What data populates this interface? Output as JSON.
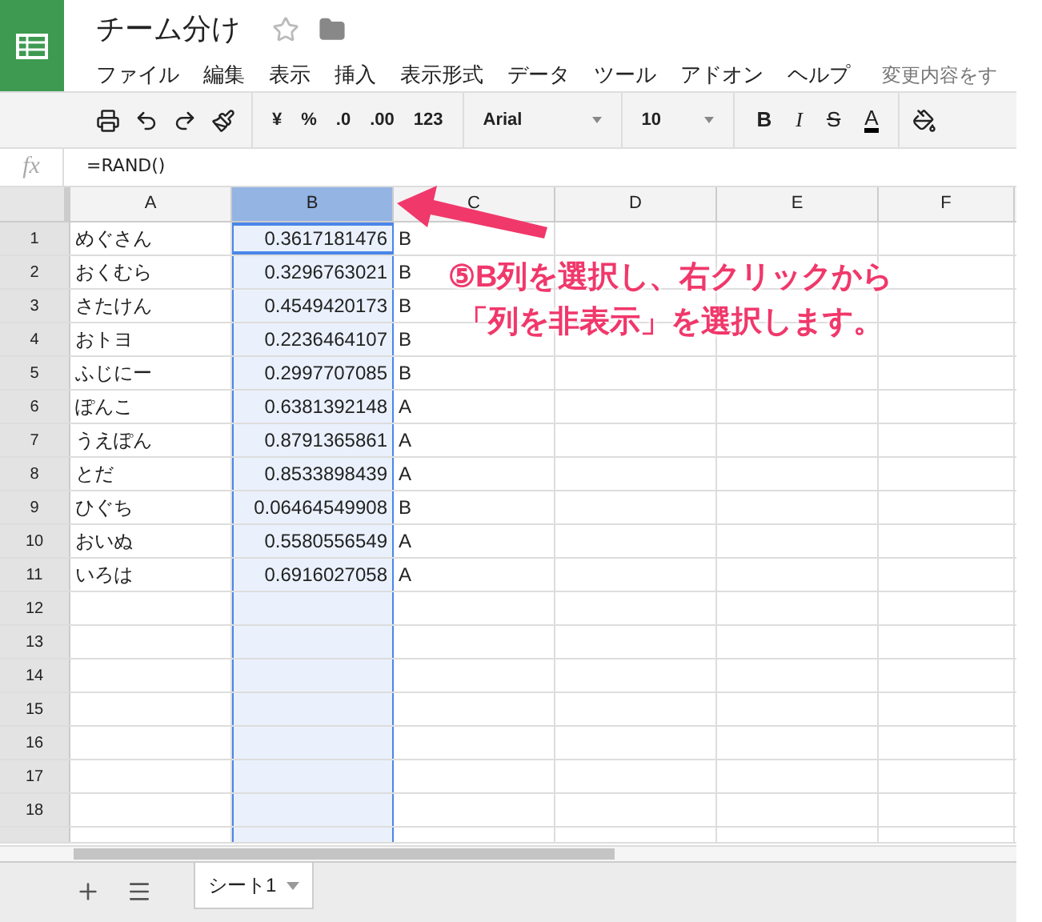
{
  "app": {
    "title": "チーム分け",
    "starred": false,
    "menu": [
      "ファイル",
      "編集",
      "表示",
      "挿入",
      "表示形式",
      "データ",
      "ツール",
      "アドオン",
      "ヘルプ"
    ],
    "save_status": "変更内容をす"
  },
  "toolbar": {
    "format_buttons": [
      "¥",
      "%",
      ".0",
      ".00",
      "123"
    ],
    "font": "Arial",
    "font_size": "10",
    "text_buttons": [
      {
        "label": "B",
        "kind": "bold"
      },
      {
        "label": "I",
        "kind": "italic"
      },
      {
        "label": "S",
        "kind": "strike"
      },
      {
        "label": "A",
        "kind": "color"
      }
    ]
  },
  "formula_bar": {
    "label": "fx",
    "value": "=RAND()"
  },
  "sheet": {
    "columns": [
      {
        "label": "A",
        "selected": false
      },
      {
        "label": "B",
        "selected": true
      },
      {
        "label": "C",
        "selected": false
      },
      {
        "label": "D",
        "selected": false
      },
      {
        "label": "E",
        "selected": false
      },
      {
        "label": "F",
        "selected": false
      }
    ],
    "rows": [
      {
        "number": "1",
        "cells": [
          "めぐさん",
          "0.3617181476",
          "B"
        ]
      },
      {
        "number": "2",
        "cells": [
          "おくむら",
          "0.3296763021",
          "B"
        ]
      },
      {
        "number": "3",
        "cells": [
          "さたけん",
          "0.4549420173",
          "B"
        ]
      },
      {
        "number": "4",
        "cells": [
          "おトヨ",
          "0.2236464107",
          "B"
        ]
      },
      {
        "number": "5",
        "cells": [
          "ふじにー",
          "0.2997707085",
          "B"
        ]
      },
      {
        "number": "6",
        "cells": [
          "ぽんこ",
          "0.6381392148",
          "A"
        ]
      },
      {
        "number": "7",
        "cells": [
          "うえぽん",
          "0.8791365861",
          "A"
        ]
      },
      {
        "number": "8",
        "cells": [
          "とだ",
          "0.8533898439",
          "A"
        ]
      },
      {
        "number": "9",
        "cells": [
          "ひぐち",
          "0.06464549908",
          "B"
        ]
      },
      {
        "number": "10",
        "cells": [
          "おいぬ",
          "0.5580556549",
          "A"
        ]
      },
      {
        "number": "11",
        "cells": [
          "いろは",
          "0.6916027058",
          "A"
        ]
      },
      {
        "number": "12",
        "cells": []
      },
      {
        "number": "13",
        "cells": []
      },
      {
        "number": "14",
        "cells": []
      },
      {
        "number": "15",
        "cells": []
      },
      {
        "number": "16",
        "cells": []
      },
      {
        "number": "17",
        "cells": []
      },
      {
        "number": "18",
        "cells": []
      }
    ]
  },
  "sheet_tabs": [
    {
      "label": "シート1",
      "selected": true
    }
  ],
  "annotation": {
    "lines": [
      "⑤B列を選択し、右クリックから",
      "「列を非表示」を選択します。"
    ]
  }
}
